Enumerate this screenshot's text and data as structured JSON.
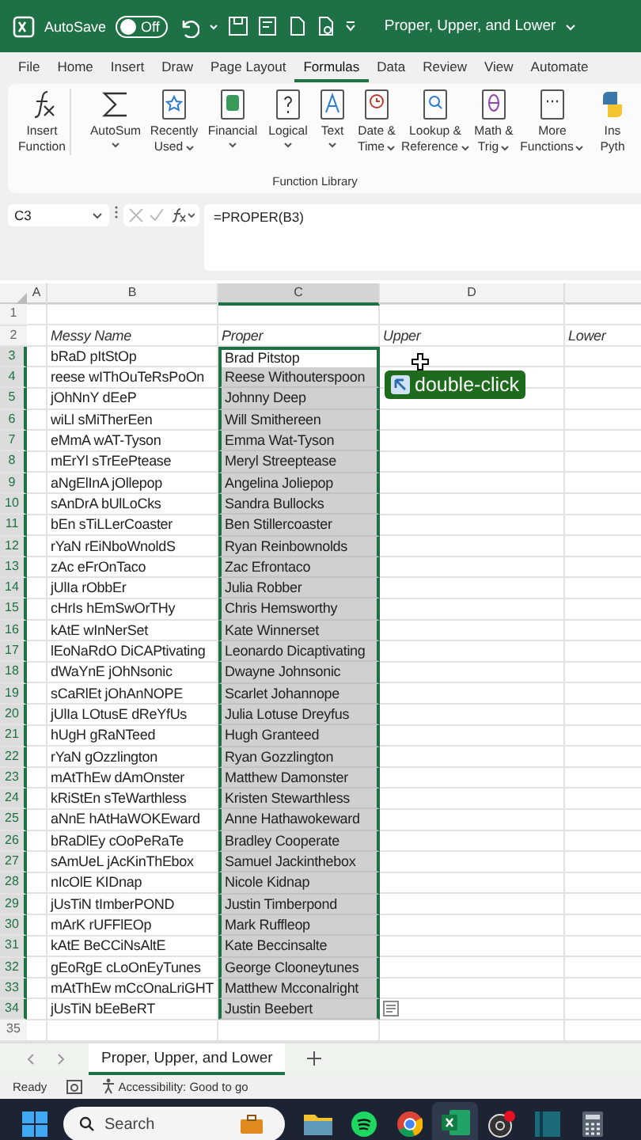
{
  "title_bar": {
    "autosave_label": "AutoSave",
    "autosave": {
      "on": false,
      "label": "Off"
    },
    "document_title": "Proper, Upper, and Lower"
  },
  "menu_tabs": [
    {
      "label": "File",
      "selected": false
    },
    {
      "label": "Home",
      "selected": false
    },
    {
      "label": "Insert",
      "selected": false
    },
    {
      "label": "Draw",
      "selected": false
    },
    {
      "label": "Page Layout",
      "selected": false
    },
    {
      "label": "Formulas",
      "selected": true
    },
    {
      "label": "Data",
      "selected": false
    },
    {
      "label": "Review",
      "selected": false
    },
    {
      "label": "View",
      "selected": false
    },
    {
      "label": "Automate",
      "selected": false
    }
  ],
  "ribbon": {
    "group_label": "Function Library",
    "buttons": [
      {
        "kind": "fx",
        "lines": [
          "Insert",
          "Function"
        ],
        "dropdown": false
      },
      {
        "kind": "sum",
        "lines": [
          "AutoSum"
        ],
        "dropdown": true
      },
      {
        "kind": "star",
        "lines": [
          "Recently",
          "Used"
        ],
        "dropdown": true
      },
      {
        "kind": "db",
        "lines": [
          "Financial"
        ],
        "dropdown": true
      },
      {
        "kind": "question",
        "lines": [
          "Logical"
        ],
        "dropdown": true
      },
      {
        "kind": "text",
        "lines": [
          "Text"
        ],
        "dropdown": true
      },
      {
        "kind": "clock",
        "lines": [
          "Date &",
          "Time"
        ],
        "dropdown": true
      },
      {
        "kind": "lookup",
        "lines": [
          "Lookup &",
          "Reference"
        ],
        "dropdown": true
      },
      {
        "kind": "theta",
        "lines": [
          "Math &",
          "Trig"
        ],
        "dropdown": true
      },
      {
        "kind": "more",
        "lines": [
          "More",
          "Functions"
        ],
        "dropdown": true
      },
      {
        "kind": "python",
        "lines": [
          "Ins",
          "Pyth"
        ],
        "dropdown": false
      }
    ]
  },
  "formula_bar": {
    "name_box": "C3",
    "formula": "=PROPER(B3)"
  },
  "grid": {
    "columns": [
      {
        "label": "A",
        "selected": false
      },
      {
        "label": "B",
        "selected": false
      },
      {
        "label": "C",
        "selected": true
      },
      {
        "label": "D",
        "selected": false
      }
    ],
    "rows": [
      {
        "number": "1",
        "kind": "empty",
        "selected": false
      },
      {
        "number": "2",
        "kind": "header",
        "selected": false,
        "messy": "Messy Name",
        "proper": "Proper",
        "upper": "Upper",
        "lower": "Lower"
      },
      {
        "number": "3",
        "kind": "data",
        "selected": true,
        "active": true,
        "messy": "bRaD pItStOp",
        "proper": "Brad Pitstop"
      },
      {
        "number": "4",
        "kind": "data",
        "selected": true,
        "active": false,
        "messy": "reese wIThOuTeRsPoOn",
        "proper": "Reese Withouterspoon"
      },
      {
        "number": "5",
        "kind": "data",
        "selected": true,
        "active": false,
        "messy": "jOhNnY dEeP",
        "proper": "Johnny Deep"
      },
      {
        "number": "6",
        "kind": "data",
        "selected": true,
        "active": false,
        "messy": "wiLl sMiTherEen",
        "proper": "Will Smithereen"
      },
      {
        "number": "7",
        "kind": "data",
        "selected": true,
        "active": false,
        "messy": "eMmA wAT-Tyson",
        "proper": "Emma Wat-Tyson"
      },
      {
        "number": "8",
        "kind": "data",
        "selected": true,
        "active": false,
        "messy": "mErYl sTrEePtease",
        "proper": "Meryl Streeptease"
      },
      {
        "number": "9",
        "kind": "data",
        "selected": true,
        "active": false,
        "messy": "aNgElInA jOllepop",
        "proper": "Angelina Joliepop"
      },
      {
        "number": "10",
        "kind": "data",
        "selected": true,
        "active": false,
        "messy": "sAnDrA bUlLoCks",
        "proper": "Sandra Bullocks"
      },
      {
        "number": "11",
        "kind": "data",
        "selected": true,
        "active": false,
        "messy": "bEn sTiLLerCoaster",
        "proper": "Ben Stillercoaster"
      },
      {
        "number": "12",
        "kind": "data",
        "selected": true,
        "active": false,
        "messy": "rYaN rEiNboWnoldS",
        "proper": "Ryan Reinbownolds"
      },
      {
        "number": "13",
        "kind": "data",
        "selected": true,
        "active": false,
        "messy": "zAc eFrOnTaco",
        "proper": "Zac Efrontaco"
      },
      {
        "number": "14",
        "kind": "data",
        "selected": true,
        "active": false,
        "messy": "jUlIa rObbEr",
        "proper": "Julia Robber"
      },
      {
        "number": "15",
        "kind": "data",
        "selected": true,
        "active": false,
        "messy": "cHrIs hEmSwOrTHy",
        "proper": "Chris Hemsworthy"
      },
      {
        "number": "16",
        "kind": "data",
        "selected": true,
        "active": false,
        "messy": "kAtE wInNerSet",
        "proper": "Kate Winnerset"
      },
      {
        "number": "17",
        "kind": "data",
        "selected": true,
        "active": false,
        "messy": "lEoNaRdO DiCAPtivating",
        "proper": "Leonardo Dicaptivating"
      },
      {
        "number": "18",
        "kind": "data",
        "selected": true,
        "active": false,
        "messy": "dWaYnE jOhNsonic",
        "proper": "Dwayne Johnsonic"
      },
      {
        "number": "19",
        "kind": "data",
        "selected": true,
        "active": false,
        "messy": "sCaRlEt jOhAnNOPE",
        "proper": "Scarlet Johannope"
      },
      {
        "number": "20",
        "kind": "data",
        "selected": true,
        "active": false,
        "messy": "jUlIa LOtusE dReYfUs",
        "proper": "Julia Lotuse Dreyfus"
      },
      {
        "number": "21",
        "kind": "data",
        "selected": true,
        "active": false,
        "messy": "hUgH gRaNTeed",
        "proper": "Hugh Granteed"
      },
      {
        "number": "22",
        "kind": "data",
        "selected": true,
        "active": false,
        "messy": "rYaN gOzzlington",
        "proper": "Ryan Gozzlington"
      },
      {
        "number": "23",
        "kind": "data",
        "selected": true,
        "active": false,
        "messy": "mAtThEw dAmOnster",
        "proper": "Matthew Damonster"
      },
      {
        "number": "24",
        "kind": "data",
        "selected": true,
        "active": false,
        "messy": "kRiStEn sTeWarthless",
        "proper": "Kristen Stewarthless"
      },
      {
        "number": "25",
        "kind": "data",
        "selected": true,
        "active": false,
        "messy": "aNnE hAtHaWOKEward",
        "proper": "Anne Hathawokeward"
      },
      {
        "number": "26",
        "kind": "data",
        "selected": true,
        "active": false,
        "messy": "bRaDlEy cOoPeRaTe",
        "proper": "Bradley Cooperate"
      },
      {
        "number": "27",
        "kind": "data",
        "selected": true,
        "active": false,
        "messy": "sAmUeL jAcKinThEbox",
        "proper": "Samuel Jackinthebox"
      },
      {
        "number": "28",
        "kind": "data",
        "selected": true,
        "active": false,
        "messy": "nIcOlE KIDnap",
        "proper": "Nicole Kidnap"
      },
      {
        "number": "29",
        "kind": "data",
        "selected": true,
        "active": false,
        "messy": "jUsTiN tImberPOND",
        "proper": "Justin Timberpond"
      },
      {
        "number": "30",
        "kind": "data",
        "selected": true,
        "active": false,
        "messy": "mArK rUFFlEOp",
        "proper": "Mark Ruffleop"
      },
      {
        "number": "31",
        "kind": "data",
        "selected": true,
        "active": false,
        "messy": "kAtE BeCCiNsAltE",
        "proper": "Kate Beccinsalte"
      },
      {
        "number": "32",
        "kind": "data",
        "selected": true,
        "active": false,
        "messy": "gEoRgE cLoOnEyTunes",
        "proper": "George Clooneytunes"
      },
      {
        "number": "33",
        "kind": "data",
        "selected": true,
        "active": false,
        "messy": "mAtThEw mCcOnaLriGHT",
        "proper": "Matthew Mcconalright"
      },
      {
        "number": "34",
        "kind": "data",
        "selected": true,
        "active": false,
        "messy": "jUsTiN bEeBeRT",
        "proper": "Justin Beebert"
      },
      {
        "number": "35",
        "kind": "empty",
        "selected": false
      }
    ]
  },
  "tooltip": {
    "label": "double-click"
  },
  "sheet_tabs": [
    {
      "label": "Proper, Upper, and Lower",
      "selected": true
    }
  ],
  "status_bar": {
    "status": "Ready",
    "accessibility": "Accessibility: Good to go"
  },
  "taskbar": {
    "search_placeholder": "Search",
    "apps": [
      {
        "kind": "folder",
        "active": false
      },
      {
        "kind": "music",
        "active": false
      },
      {
        "kind": "browser",
        "active": false
      },
      {
        "kind": "excel",
        "active": true
      },
      {
        "kind": "record",
        "active": false
      },
      {
        "kind": "panel",
        "active": false
      },
      {
        "kind": "calculator",
        "active": false
      }
    ]
  }
}
